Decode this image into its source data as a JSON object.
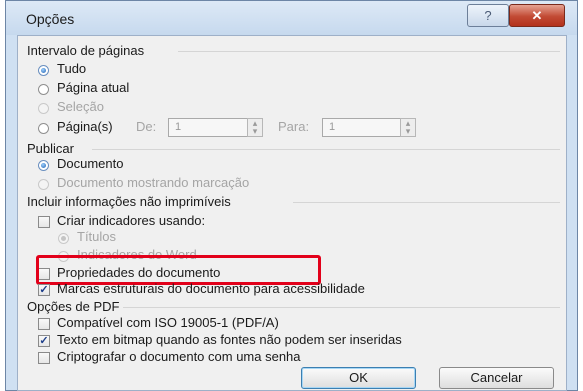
{
  "dialog": {
    "title": "Opções"
  },
  "page_range": {
    "heading": "Intervalo de páginas",
    "all": "Tudo",
    "current_page": "Página atual",
    "selection": "Seleção",
    "pages": "Página(s)",
    "from_label": "De:",
    "from_value": "1",
    "to_label": "Para:",
    "to_value": "1"
  },
  "publish": {
    "heading": "Publicar",
    "document": "Documento",
    "document_markup": "Documento mostrando marcação"
  },
  "nonprint": {
    "heading": "Incluir informações não imprimíveis",
    "create_bookmarks": "Criar indicadores usando:",
    "headings": "Títulos",
    "word_bookmarks": "Indicadores do Word",
    "doc_properties": "Propriedades do documento",
    "structure_tags": "Marcas estruturais do documento para acessibilidade"
  },
  "pdf": {
    "heading": "Opções de PDF",
    "iso": "Compatível com ISO 19005-1 (PDF/A)",
    "bitmap": "Texto em bitmap quando as fontes não podem ser inseridas",
    "encrypt": "Criptografar o documento com uma senha"
  },
  "buttons": {
    "ok": "OK",
    "cancel": "Cancelar"
  }
}
